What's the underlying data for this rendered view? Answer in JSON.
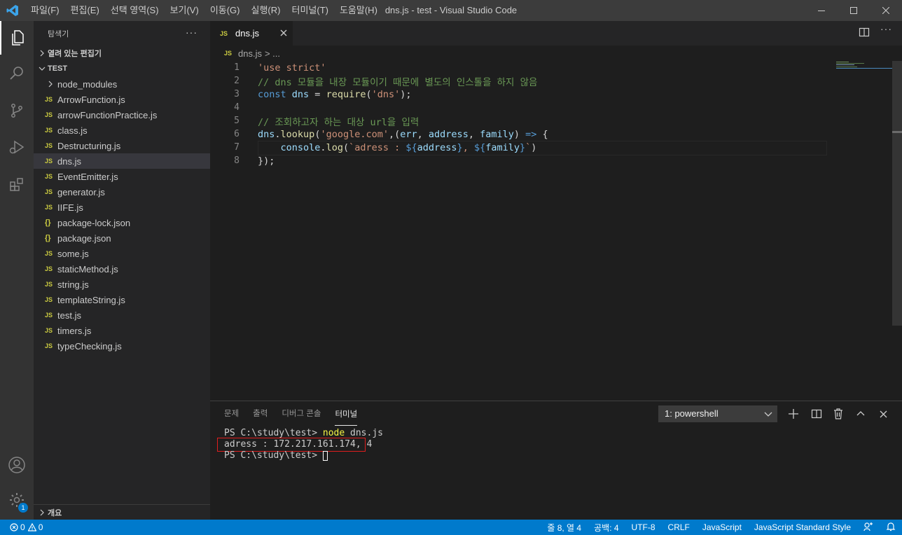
{
  "window": {
    "title": "dns.js - test - Visual Studio Code",
    "menu": [
      "파일(F)",
      "편집(E)",
      "선택 영역(S)",
      "보기(V)",
      "이동(G)",
      "실행(R)",
      "터미널(T)",
      "도움말(H)"
    ]
  },
  "activity_bar": {
    "icons": [
      "explorer-icon",
      "search-icon",
      "source-control-icon",
      "run-debug-icon",
      "extensions-icon",
      "account-icon",
      "settings-gear-icon"
    ],
    "settings_badge": "1"
  },
  "sidebar": {
    "title": "탐색기",
    "more": "···",
    "open_editors_label": "열려 있는 편집기",
    "folder_label": "TEST",
    "files": [
      {
        "name": "node_modules",
        "type": "folder"
      },
      {
        "name": "ArrowFunction.js",
        "type": "js"
      },
      {
        "name": "arrowFunctionPractice.js",
        "type": "js"
      },
      {
        "name": "class.js",
        "type": "js"
      },
      {
        "name": "Destructuring.js",
        "type": "js"
      },
      {
        "name": "dns.js",
        "type": "js",
        "selected": true
      },
      {
        "name": "EventEmitter.js",
        "type": "js"
      },
      {
        "name": "generator.js",
        "type": "js"
      },
      {
        "name": "IIFE.js",
        "type": "js"
      },
      {
        "name": "package-lock.json",
        "type": "json"
      },
      {
        "name": "package.json",
        "type": "json"
      },
      {
        "name": "some.js",
        "type": "js"
      },
      {
        "name": "staticMethod.js",
        "type": "js"
      },
      {
        "name": "string.js",
        "type": "js"
      },
      {
        "name": "templateString.js",
        "type": "js"
      },
      {
        "name": "test.js",
        "type": "js"
      },
      {
        "name": "timers.js",
        "type": "js"
      },
      {
        "name": "typeChecking.js",
        "type": "js"
      }
    ],
    "outline_label": "개요",
    "js_badge": "JS",
    "json_badge": "{}"
  },
  "editor": {
    "tab_label": "dns.js",
    "breadcrumb_file": "dns.js",
    "breadcrumb_rest": "> ...",
    "code_lines": [
      {
        "n": "1",
        "tokens": [
          {
            "t": "'use strict'",
            "c": "str"
          }
        ]
      },
      {
        "n": "2",
        "tokens": [
          {
            "t": "// dns 모듈을 내장 모듈이기 때문에 별도의 인스톨을 하지 않음",
            "c": "cmt"
          }
        ]
      },
      {
        "n": "3",
        "tokens": [
          {
            "t": "const",
            "c": "kw"
          },
          {
            "t": " ",
            "c": "pun"
          },
          {
            "t": "dns",
            "c": "var"
          },
          {
            "t": " = ",
            "c": "pun"
          },
          {
            "t": "require",
            "c": "fn"
          },
          {
            "t": "(",
            "c": "pun"
          },
          {
            "t": "'dns'",
            "c": "str"
          },
          {
            "t": ");",
            "c": "pun"
          }
        ]
      },
      {
        "n": "4",
        "tokens": []
      },
      {
        "n": "5",
        "tokens": [
          {
            "t": "// 조회하고자 하는 대상 url을 입력",
            "c": "cmt"
          }
        ]
      },
      {
        "n": "6",
        "tokens": [
          {
            "t": "dns",
            "c": "var"
          },
          {
            "t": ".",
            "c": "pun"
          },
          {
            "t": "lookup",
            "c": "fn"
          },
          {
            "t": "(",
            "c": "pun"
          },
          {
            "t": "'google.com'",
            "c": "str"
          },
          {
            "t": ",(",
            "c": "pun"
          },
          {
            "t": "err",
            "c": "var"
          },
          {
            "t": ", ",
            "c": "pun"
          },
          {
            "t": "address",
            "c": "var"
          },
          {
            "t": ", ",
            "c": "pun"
          },
          {
            "t": "family",
            "c": "var"
          },
          {
            "t": ") ",
            "c": "pun"
          },
          {
            "t": "=>",
            "c": "kw"
          },
          {
            "t": " {",
            "c": "pun"
          }
        ]
      },
      {
        "n": "7",
        "tokens": [
          {
            "t": "    ",
            "c": "pun"
          },
          {
            "t": "console",
            "c": "var"
          },
          {
            "t": ".",
            "c": "pun"
          },
          {
            "t": "log",
            "c": "fn"
          },
          {
            "t": "(",
            "c": "pun"
          },
          {
            "t": "`adress : ",
            "c": "str"
          },
          {
            "t": "${",
            "c": "kw"
          },
          {
            "t": "address",
            "c": "var"
          },
          {
            "t": "}",
            "c": "kw"
          },
          {
            "t": ", ",
            "c": "str"
          },
          {
            "t": "${",
            "c": "kw"
          },
          {
            "t": "family",
            "c": "var"
          },
          {
            "t": "}",
            "c": "kw"
          },
          {
            "t": "`",
            "c": "str"
          },
          {
            "t": ")",
            "c": "pun"
          }
        ]
      },
      {
        "n": "8",
        "tokens": [
          {
            "t": "});",
            "c": "pun"
          }
        ]
      }
    ]
  },
  "panel": {
    "tabs": [
      "문제",
      "출력",
      "디버그 콘솔",
      "터미널"
    ],
    "active_tab": "터미널",
    "terminal_select": "1: powershell",
    "terminal_lines": [
      {
        "prompt": "PS C:\\study\\test> ",
        "cmd": "node",
        "rest": " dns.js"
      },
      {
        "output": "adress : 172.217.161.174, 4"
      },
      {
        "prompt": "PS C:\\study\\test> ",
        "cursor": true
      }
    ]
  },
  "statusbar": {
    "errors": "0",
    "warnings": "0",
    "position": "줄 8, 열 4",
    "spaces": "공백: 4",
    "encoding": "UTF-8",
    "eol": "CRLF",
    "language": "JavaScript",
    "style": "JavaScript Standard Style"
  },
  "colors": {
    "accent": "#007acc",
    "highlight_box": "#e01e1e",
    "js_icon": "#cbcb41"
  }
}
